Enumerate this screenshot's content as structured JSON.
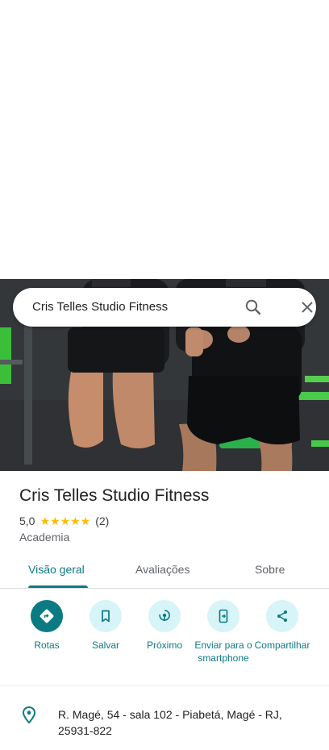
{
  "search": {
    "query": "Cris Telles Studio Fitness"
  },
  "place": {
    "name": "Cris Telles Studio Fitness",
    "rating": "5,0",
    "stars": "★★★★★",
    "review_count": "(2)",
    "category": "Academia"
  },
  "tabs": [
    {
      "label": "Visão geral",
      "active": true
    },
    {
      "label": "Avaliações",
      "active": false
    },
    {
      "label": "Sobre",
      "active": false
    }
  ],
  "actions": [
    {
      "label": "Rotas",
      "icon": "directions-icon"
    },
    {
      "label": "Salvar",
      "icon": "bookmark-icon"
    },
    {
      "label": "Próximo",
      "icon": "nearby-icon"
    },
    {
      "label": "Enviar para o smartphone",
      "icon": "send-to-phone-icon"
    },
    {
      "label": "Compartilhar",
      "icon": "share-icon"
    }
  ],
  "address": {
    "text": "R. Magé, 54 - sala 102 - Piabetá, Magé - RJ, 25931-822"
  },
  "colors": {
    "accent": "#0b7a83",
    "accent_light": "#d7f4f8",
    "star": "#fbbc04"
  }
}
